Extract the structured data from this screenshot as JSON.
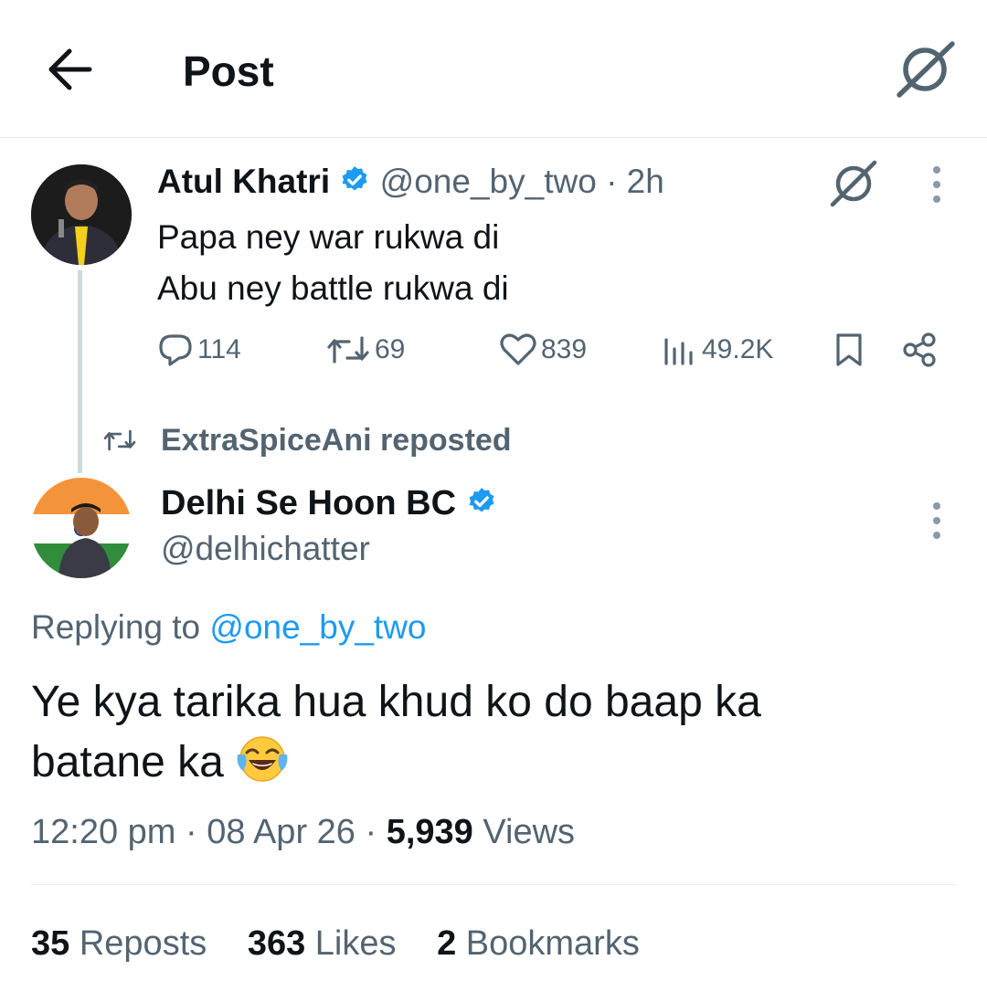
{
  "header": {
    "title": "Post",
    "back_icon": "arrow-left-icon",
    "grok_icon": "grok-icon"
  },
  "parent_tweet": {
    "author_name": "Atul Khatri",
    "handle": "@one_by_two",
    "separator": "·",
    "time": "2h",
    "lines": [
      "Papa ney war rukwa di",
      "Abu ney battle rukwa di"
    ],
    "actions": {
      "replies": "114",
      "reposts": "69",
      "likes": "839",
      "views": "49.2K"
    }
  },
  "repost_indicator": {
    "text": "ExtraSpiceAni reposted"
  },
  "main_tweet": {
    "author_name": "Delhi Se Hoon BC",
    "handle": "@delhichatter",
    "replying_prefix": "Replying to",
    "replying_handle": "@one_by_two",
    "text_line1": "Ye kya tarika hua khud ko do baap ka",
    "text_line2": "batane ka",
    "emoji": "face-with-tears-of-joy",
    "time": "12:20 pm",
    "date": "08 Apr 26",
    "dot": "·",
    "views_count": "5,939",
    "views_label": "Views"
  },
  "stats": {
    "reposts_count": "35",
    "reposts_label": "Reposts",
    "likes_count": "363",
    "likes_label": "Likes",
    "bookmarks_count": "2",
    "bookmarks_label": "Bookmarks"
  },
  "colors": {
    "accent": "#1d9bf0",
    "muted": "#536471",
    "text": "#0f1419",
    "divider": "#e7e9ec"
  }
}
